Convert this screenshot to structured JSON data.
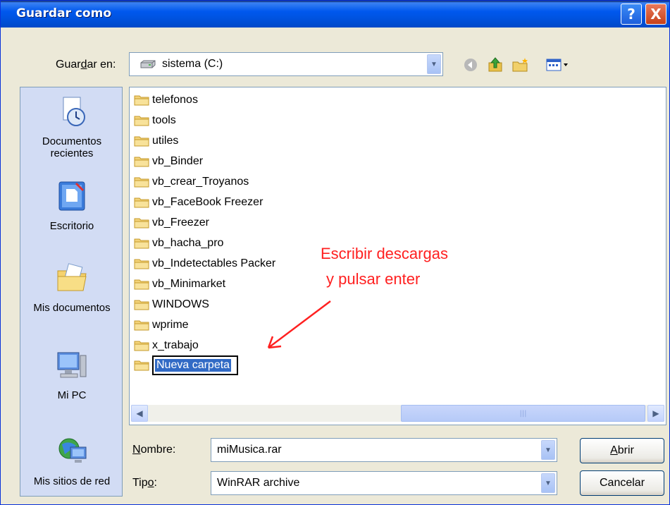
{
  "window": {
    "title": "Guardar como"
  },
  "save_in": {
    "label_pre": "Guar",
    "label_key": "d",
    "label_post": "ar en:",
    "value": "sistema (C:)"
  },
  "icons": {
    "help": "?",
    "close": "X",
    "back": "back-arrow-icon",
    "up": "up-folder-icon",
    "new_folder": "new-folder-icon",
    "view_menu": "view-menu-icon"
  },
  "places": [
    {
      "label_line1": "Documentos",
      "label_line2": "recientes",
      "icon": "recent-documents-icon"
    },
    {
      "label_line1": "Escritorio",
      "label_line2": "",
      "icon": "desktop-icon"
    },
    {
      "label_line1": "Mis documentos",
      "label_line2": "",
      "icon": "my-documents-icon"
    },
    {
      "label_line1": "Mi PC",
      "label_line2": "",
      "icon": "my-computer-icon"
    },
    {
      "label_line1": "Mis sitios de red",
      "label_line2": "",
      "icon": "network-places-icon"
    }
  ],
  "files": [
    {
      "name": "telefonos"
    },
    {
      "name": "tools"
    },
    {
      "name": "utiles"
    },
    {
      "name": "vb_Binder"
    },
    {
      "name": "vb_crear_Troyanos"
    },
    {
      "name": "vb_FaceBook Freezer"
    },
    {
      "name": "vb_Freezer"
    },
    {
      "name": "vb_hacha_pro"
    },
    {
      "name": "vb_Indetectables Packer"
    },
    {
      "name": "vb_Minimarket"
    },
    {
      "name": "WINDOWS"
    },
    {
      "name": "wprime"
    },
    {
      "name": "x_trabajo"
    }
  ],
  "new_folder_name": "Nueva carpeta",
  "annotation": {
    "line1": "Escribir  descargas",
    "line2": "y pulsar  enter",
    "color": "#FF2020"
  },
  "filename": {
    "label_key": "N",
    "label_post": "ombre:",
    "value": "miMusica.rar"
  },
  "filetype": {
    "label_pre": "Tip",
    "label_key": "o",
    "label_post": ":",
    "value": "WinRAR archive"
  },
  "buttons": {
    "open_key": "A",
    "open_post": "brir",
    "cancel": "Cancelar"
  },
  "colors": {
    "titlebar": "#0054E3",
    "dialog_bg": "#ECE9D8",
    "places_bg": "#D2DCF4",
    "selection": "#316AC5"
  }
}
